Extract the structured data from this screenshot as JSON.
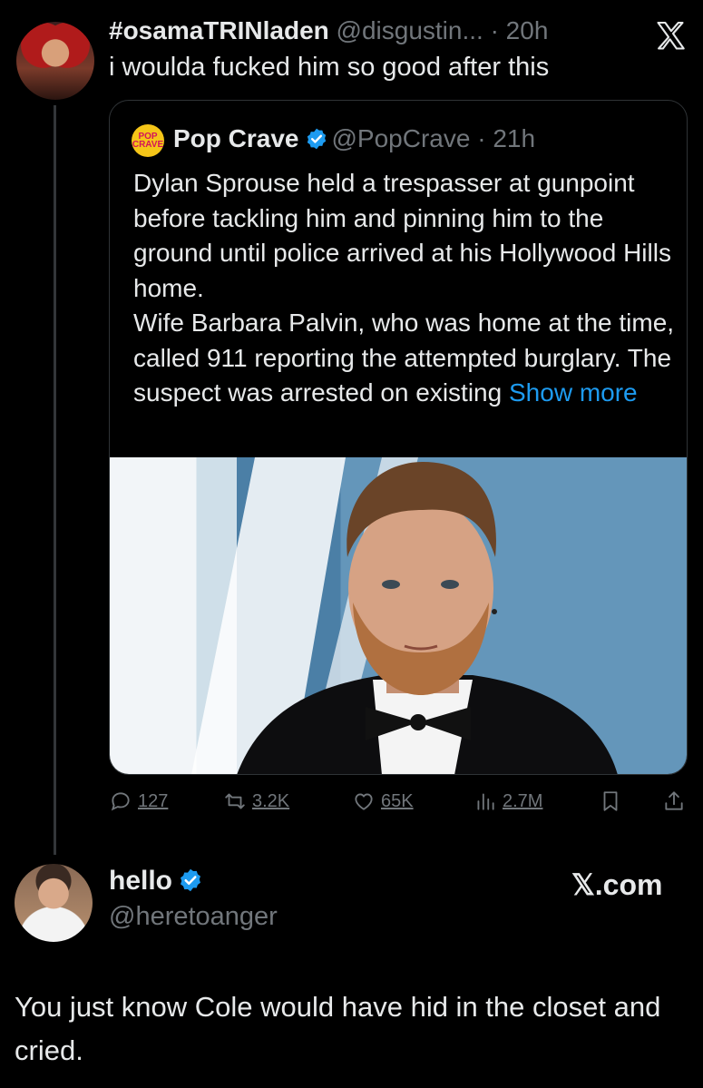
{
  "tweet": {
    "author_name": "#osamaTRINladen",
    "meta": "@disgustin... · 20h",
    "text": "i woulda fucked him so good after this"
  },
  "quote": {
    "logo_text": "POP CRAVE",
    "author_name": "Pop Crave",
    "meta": "@PopCrave · 21h",
    "body": "Dylan Sprouse held a trespasser at gunpoint before tackling him and pinning him to the ground until police arrived at his Hollywood Hills home.\nWife Barbara Palvin, who was home at the time, called 911 reporting the attempted burglary. The suspect was arrested on existing",
    "show_more": "Show more"
  },
  "actions": {
    "replies": "127",
    "reposts": "3.2K",
    "likes": "65K",
    "views": "2.7M"
  },
  "profile": {
    "name": "hello",
    "handle": "@heretoanger",
    "site": "𝕏.com"
  },
  "bottom_text": "You just know Cole would have hid in the closet and cried.",
  "colors": {
    "background": "#000000",
    "text": "#e7e9ea",
    "muted": "#71767b",
    "accent": "#1d9bf0",
    "border": "#2f3336"
  },
  "icons": [
    "x-logo-icon",
    "verified-badge-icon",
    "reply-icon",
    "repost-icon",
    "like-icon",
    "views-icon",
    "bookmark-icon",
    "share-icon"
  ]
}
